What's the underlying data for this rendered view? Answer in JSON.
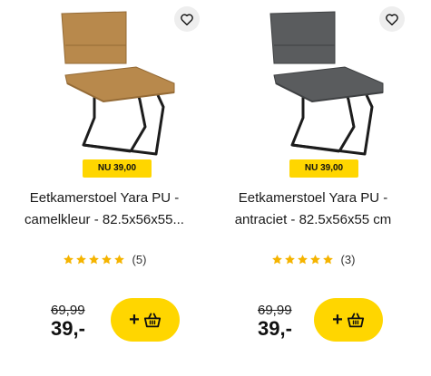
{
  "products": [
    {
      "badge": "NU 39,00",
      "title_line1": "Eetkamerstoel Yara PU -",
      "title_line2": "camelkleur - 82.5x56x55...",
      "review_count": "(5)",
      "rating": 5,
      "old_price": "69,99",
      "new_price": "39,-",
      "add_label": "+",
      "chair_color": "#b8894c",
      "chair_shade": "#946a35"
    },
    {
      "badge": "NU 39,00",
      "title_line1": "Eetkamerstoel Yara PU -",
      "title_line2": "antraciet - 82.5x56x55 cm",
      "review_count": "(3)",
      "rating": 5,
      "old_price": "69,99",
      "new_price": "39,-",
      "add_label": "+",
      "chair_color": "#5a5c5e",
      "chair_shade": "#3e4042"
    }
  ],
  "colors": {
    "accent": "#ffd600",
    "star": "#f5b400"
  },
  "icons": {
    "favorite": "heart-icon",
    "basket": "basket-icon",
    "star": "star-icon"
  }
}
